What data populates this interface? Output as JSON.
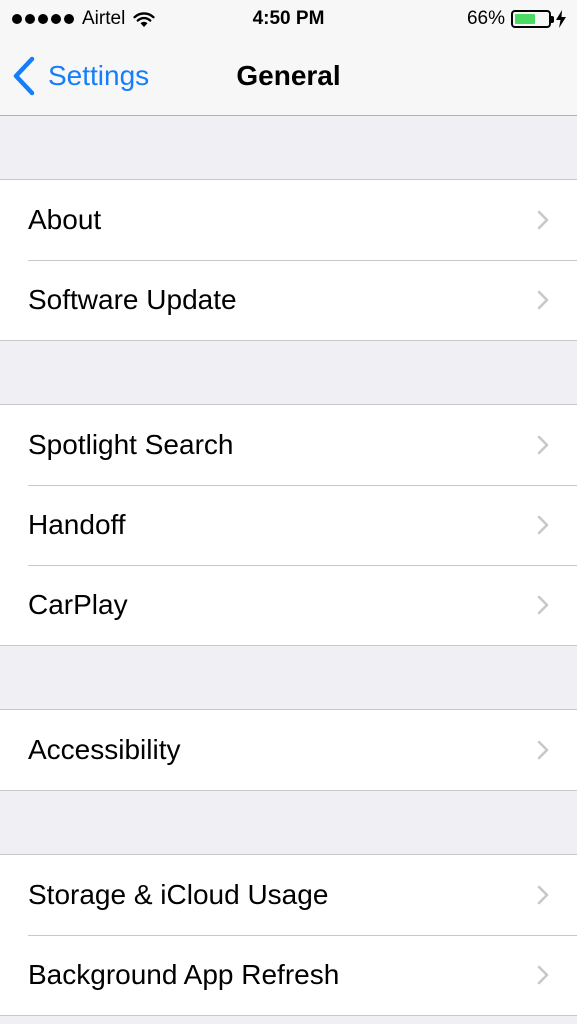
{
  "status_bar": {
    "carrier": "Airtel",
    "time": "4:50 PM",
    "battery_percent": "66%",
    "battery_level": 0.66,
    "signal_icon": "signal-dots-icon",
    "wifi_icon": "wifi-icon",
    "charging_icon": "bolt-icon"
  },
  "nav": {
    "back_label": "Settings",
    "back_icon": "chevron-left-icon",
    "title": "General"
  },
  "colors": {
    "accent": "#157efb",
    "background": "#efeff4",
    "battery": "#4cd964"
  },
  "groups": [
    {
      "items": [
        {
          "label": "About"
        },
        {
          "label": "Software Update"
        }
      ]
    },
    {
      "items": [
        {
          "label": "Spotlight Search"
        },
        {
          "label": "Handoff"
        },
        {
          "label": "CarPlay"
        }
      ]
    },
    {
      "items": [
        {
          "label": "Accessibility"
        }
      ]
    },
    {
      "items": [
        {
          "label": "Storage & iCloud Usage"
        },
        {
          "label": "Background App Refresh"
        }
      ]
    }
  ]
}
